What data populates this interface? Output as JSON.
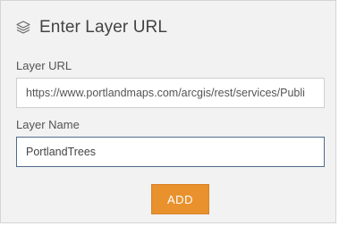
{
  "header": {
    "title": "Enter Layer URL",
    "icon": "layers-icon"
  },
  "form": {
    "url_label": "Layer URL",
    "url_value": "https://www.portlandmaps.com/arcgis/rest/services/Publi",
    "name_label": "Layer Name",
    "name_value": "PortlandTrees"
  },
  "actions": {
    "add_label": "ADD"
  },
  "colors": {
    "panel_bg": "#f2f2f2",
    "button_orange": "#e8912d",
    "focus_border": "#506b8a"
  }
}
